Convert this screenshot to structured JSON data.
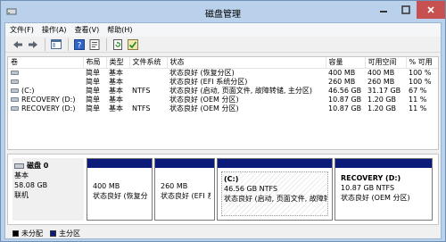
{
  "window": {
    "title": "磁盘管理"
  },
  "menu": [
    "文件(F)",
    "操作(A)",
    "查看(V)",
    "帮助(H)"
  ],
  "toolbar": {
    "icons": [
      "back-arrow-icon",
      "forward-arrow-icon",
      "console-tree-icon",
      "help-icon",
      "properties-icon",
      "refresh-icon",
      "check-icon"
    ]
  },
  "table": {
    "columns": [
      "卷",
      "布局",
      "类型",
      "文件系统",
      "状态",
      "容量",
      "可用空间",
      "% 可用"
    ],
    "rows": [
      {
        "volume": "",
        "layout": "简单",
        "type": "基本",
        "fs": "",
        "status": "状态良好 (恢复分区)",
        "capacity": "400 MB",
        "free": "400 MB",
        "pct": "100 %"
      },
      {
        "volume": "",
        "layout": "简单",
        "type": "基本",
        "fs": "",
        "status": "状态良好 (EFI 系统分区)",
        "capacity": "260 MB",
        "free": "260 MB",
        "pct": "100 %"
      },
      {
        "volume": "(C:)",
        "layout": "简单",
        "type": "基本",
        "fs": "NTFS",
        "status": "状态良好 (启动, 页面文件, 故障转储, 主分区)",
        "capacity": "46.56 GB",
        "free": "31.17 GB",
        "pct": "67 %"
      },
      {
        "volume": "RECOVERY (D:)",
        "layout": "简单",
        "type": "基本",
        "fs": "",
        "status": "状态良好 (OEM 分区)",
        "capacity": "10.87 GB",
        "free": "1.20 GB",
        "pct": "11 %"
      },
      {
        "volume": "RECOVERY (D:)",
        "layout": "简单",
        "type": "基本",
        "fs": "NTFS",
        "status": "状态良好 (OEM 分区)",
        "capacity": "10.87 GB",
        "free": "1.20 GB",
        "pct": "11 %"
      }
    ]
  },
  "disk": {
    "name": "磁盘 0",
    "type": "基本",
    "size": "58.08 GB",
    "state": "联机",
    "partitions": [
      {
        "name": "",
        "size": "400 MB",
        "status": "状态良好 (恢复分区"
      },
      {
        "name": "",
        "size": "260 MB",
        "status": "状态良好 (EFI 系统分"
      },
      {
        "name": "(C:)",
        "size": "46.56 GB NTFS",
        "status": "状态良好 (启动, 页面文件, 故障转储"
      },
      {
        "name": "RECOVERY  (D:)",
        "size": "10.87 GB NTFS",
        "status": "状态良好 (OEM 分区)"
      }
    ]
  },
  "legend": [
    {
      "label": "未分配",
      "color": "#000000"
    },
    {
      "label": "主分区",
      "color": "#0c1a7a"
    }
  ]
}
